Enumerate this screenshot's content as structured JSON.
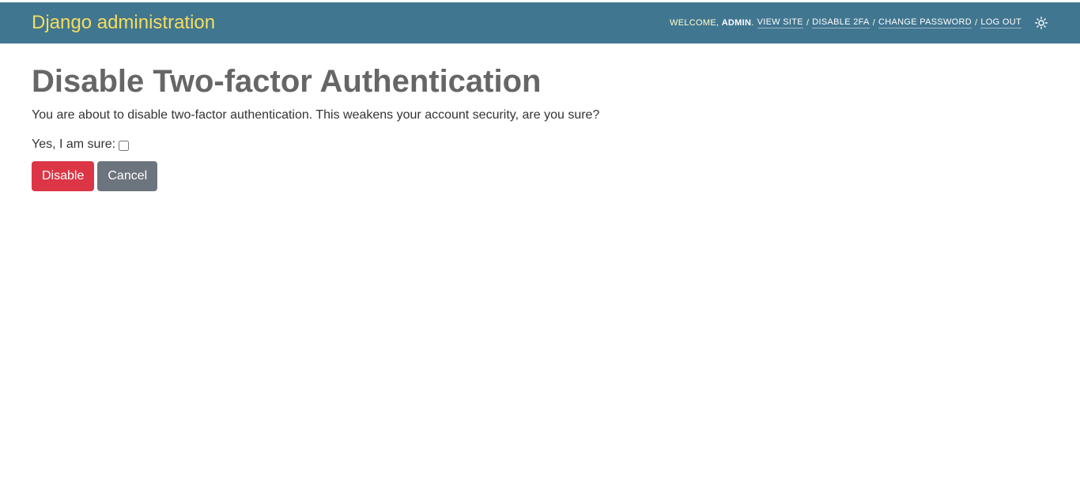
{
  "header": {
    "brand": "Django administration",
    "welcome": "Welcome,",
    "username": "admin",
    "links": {
      "view_site": "View site",
      "disable_2fa": "Disable 2FA",
      "change_password": "Change password",
      "log_out": "Log out"
    },
    "separator": "/",
    "theme_icon": "sun-icon"
  },
  "main": {
    "title": "Disable Two-factor Authentication",
    "intro": "You are about to disable two-factor authentication. This weakens your account security, are you sure?",
    "confirm_label": "Yes, I am sure:",
    "confirm_checked": false,
    "disable_label": "Disable",
    "cancel_label": "Cancel"
  },
  "colors": {
    "header_bg": "#417690",
    "brand": "#f5dd5d",
    "danger": "#dc3545",
    "secondary": "#6c757d"
  }
}
